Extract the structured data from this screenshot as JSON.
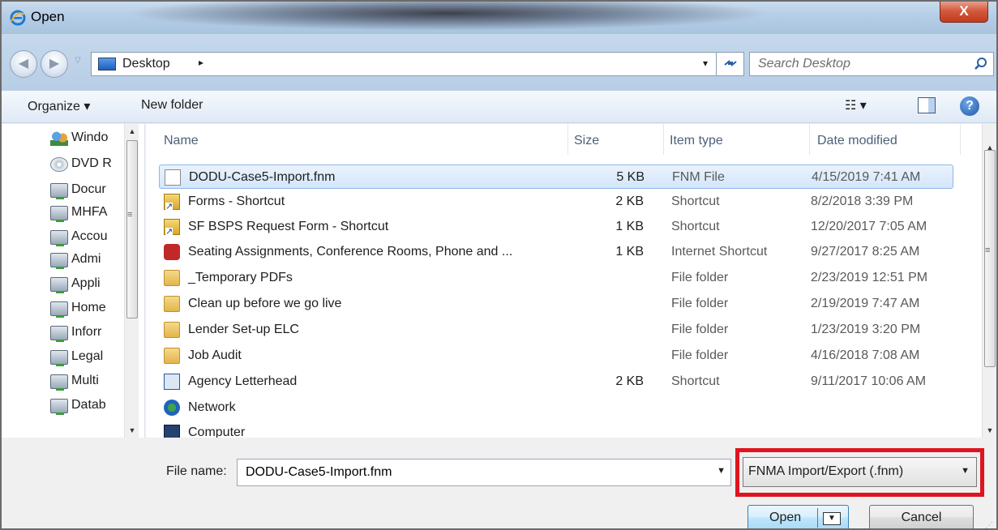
{
  "window": {
    "title": "Open",
    "close_glyph": "X"
  },
  "address": {
    "location": "Desktop",
    "chevron": "▸",
    "dropdown_glyph": "▾",
    "refresh_glyph": "↻",
    "search_placeholder": "Search Desktop"
  },
  "toolbar": {
    "organize": "Organize ▾",
    "new_folder": "New folder",
    "views_glyph": "☷ ▾",
    "help_glyph": "?"
  },
  "nav_pane": {
    "items": [
      {
        "label": "Windo",
        "icon": "users-folder-icon"
      },
      {
        "label": "DVD R",
        "icon": "dvd-drive-icon"
      },
      {
        "label": "Docur",
        "icon": "network-drive-icon"
      },
      {
        "label": "MHFA",
        "icon": "network-drive-icon"
      },
      {
        "label": "Accou",
        "icon": "network-drive-icon"
      },
      {
        "label": "Admi",
        "icon": "network-drive-icon"
      },
      {
        "label": "Appli",
        "icon": "network-drive-icon"
      },
      {
        "label": "Home",
        "icon": "network-drive-icon"
      },
      {
        "label": "Inforr",
        "icon": "network-drive-icon"
      },
      {
        "label": "Legal",
        "icon": "network-drive-icon"
      },
      {
        "label": "Multi",
        "icon": "network-drive-icon"
      },
      {
        "label": "Datab",
        "icon": "network-drive-icon"
      }
    ],
    "grip": "≡"
  },
  "file_list": {
    "columns": {
      "name": "Name",
      "size": "Size",
      "type": "Item type",
      "date": "Date modified"
    },
    "rows": [
      {
        "name": "DODU-Case5-Import.fnm",
        "size": "5 KB",
        "type": "FNM File",
        "date": "4/15/2019 7:41 AM",
        "icon": "document-icon",
        "selected": true
      },
      {
        "name": "Forms - Shortcut",
        "size": "2 KB",
        "type": "Shortcut",
        "date": "8/2/2018 3:39 PM",
        "icon": "shortcut-icon"
      },
      {
        "name": "SF BSPS Request Form - Shortcut",
        "size": "1 KB",
        "type": "Shortcut",
        "date": "12/20/2017 7:05 AM",
        "icon": "shortcut-icon"
      },
      {
        "name": "Seating Assignments, Conference Rooms, Phone and ...",
        "size": "1 KB",
        "type": "Internet Shortcut",
        "date": "9/27/2017 8:25 AM",
        "icon": "internet-shortcut-icon"
      },
      {
        "name": "_Temporary PDFs",
        "size": "",
        "type": "File folder",
        "date": "2/23/2019 12:51 PM",
        "icon": "folder-icon"
      },
      {
        "name": "Clean up before we go live",
        "size": "",
        "type": "File folder",
        "date": "2/19/2019 7:47 AM",
        "icon": "folder-icon"
      },
      {
        "name": "Lender Set-up ELC",
        "size": "",
        "type": "File folder",
        "date": "1/23/2019 3:20 PM",
        "icon": "folder-icon"
      },
      {
        "name": "Job Audit",
        "size": "",
        "type": "File folder",
        "date": "4/16/2018 7:08 AM",
        "icon": "folder-icon"
      },
      {
        "name": "Agency Letterhead",
        "size": "2 KB",
        "type": "Shortcut",
        "date": "9/11/2017 10:06 AM",
        "icon": "letterhead-shortcut-icon"
      },
      {
        "name": "Network",
        "size": "",
        "type": "",
        "date": "",
        "icon": "network-icon"
      },
      {
        "name": "Computer",
        "size": "",
        "type": "",
        "date": "",
        "icon": "computer-icon"
      }
    ],
    "grip": "≡"
  },
  "bottom": {
    "file_name_label": "File name:",
    "file_name_value": "DODU-Case5-Import.fnm",
    "file_type": "FNMA Import/Export (.fnm)",
    "open_label": "Open",
    "cancel_label": "Cancel"
  },
  "colors": {
    "highlight_box": "#e0141e",
    "selection": "#d3e6fb"
  }
}
